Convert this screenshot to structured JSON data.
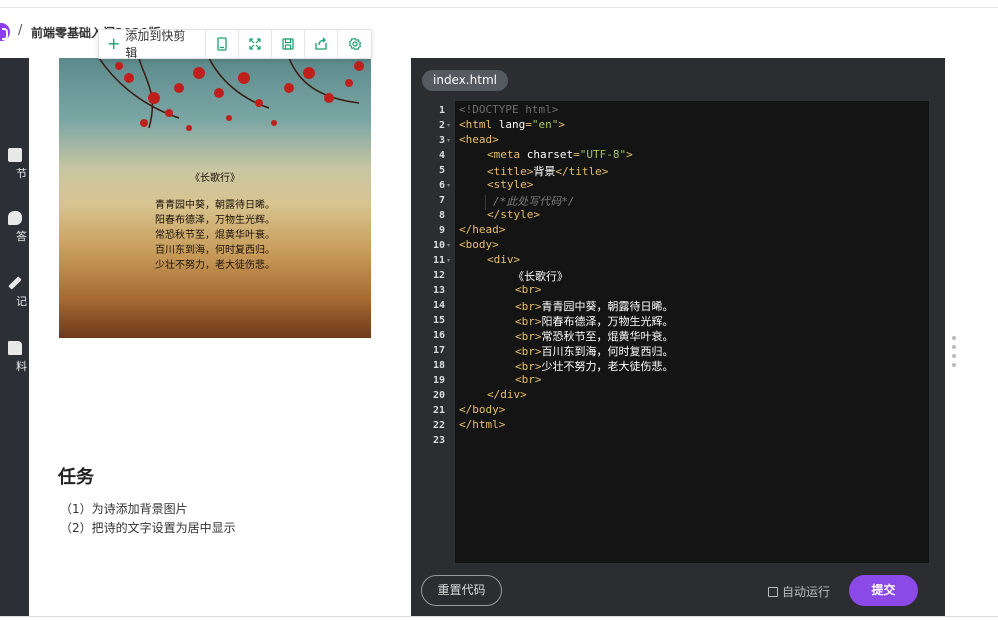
{
  "header": {
    "separator": "/",
    "breadcrumb": "前端零基础入门2020版",
    "toolbar": {
      "add_label": "添加到快剪辑"
    }
  },
  "sidebar": {
    "items": [
      {
        "label": "节",
        "icon": "list-icon"
      },
      {
        "label": "答",
        "icon": "chat-icon"
      },
      {
        "label": "记",
        "icon": "pen-icon"
      },
      {
        "label": "料",
        "icon": "folder-icon"
      }
    ]
  },
  "preview": {
    "poem_title": "《长歌行》",
    "poem_lines": [
      "青青园中葵，朝露待日晞。",
      "阳春布德泽，万物生光辉。",
      "常恐秋节至，焜黄华叶衰。",
      "百川东到海，何时复西归。",
      "少壮不努力，老大徒伤悲。"
    ]
  },
  "task": {
    "title": "任务",
    "items": [
      "（1）为诗添加背景图片",
      "（2）把诗的文字设置为居中显示"
    ]
  },
  "editor": {
    "tab": "index.html",
    "line_numbers": [
      "1",
      "2",
      "3",
      "4",
      "5",
      "6",
      "7",
      "8",
      "9",
      "10",
      "11",
      "12",
      "13",
      "14",
      "15",
      "16",
      "17",
      "18",
      "19",
      "20",
      "21",
      "22",
      "23"
    ],
    "code": {
      "l1": "<!DOCTYPE html>",
      "l2_open": "<html ",
      "l2_attr": "lang",
      "l2_eq": "=",
      "l2_val": "\"en\"",
      "l2_close": ">",
      "l3": "<head>",
      "l4_open": "<meta ",
      "l4_attr": "charset",
      "l4_eq": "=",
      "l4_val": "\"UTF-8\"",
      "l4_close": ">",
      "l5_open": "<title>",
      "l5_text": "背景",
      "l5_close": "</title>",
      "l6": "<style>",
      "l7": "/*此处写代码*/",
      "l8": "</style>",
      "l9": "</head>",
      "l10": "<body>",
      "l11": "<div>",
      "l12": "《长歌行》",
      "l13": "<br>",
      "l14_tag": "<br>",
      "l14_text": "青青园中葵，朝露待日晞。",
      "l15_tag": "<br>",
      "l15_text": "阳春布德泽，万物生光辉。",
      "l16_tag": "<br>",
      "l16_text": "常恐秋节至，焜黄华叶衰。",
      "l17_tag": "<br>",
      "l17_text": "百川东到海，何时复西归。",
      "l18_tag": "<br>",
      "l18_text": "少壮不努力，老大徒伤悲。",
      "l19": "<br>",
      "l20": "</div>",
      "l21": "</body>",
      "l22": "</html>"
    },
    "footer": {
      "reset_label": "重置代码",
      "auto_run_label": "自动运行",
      "submit_label": "提交"
    }
  },
  "colors": {
    "accent": "#8b4ae8",
    "toolbar_icon": "#1aa06d",
    "editor_bg": "#141414"
  }
}
